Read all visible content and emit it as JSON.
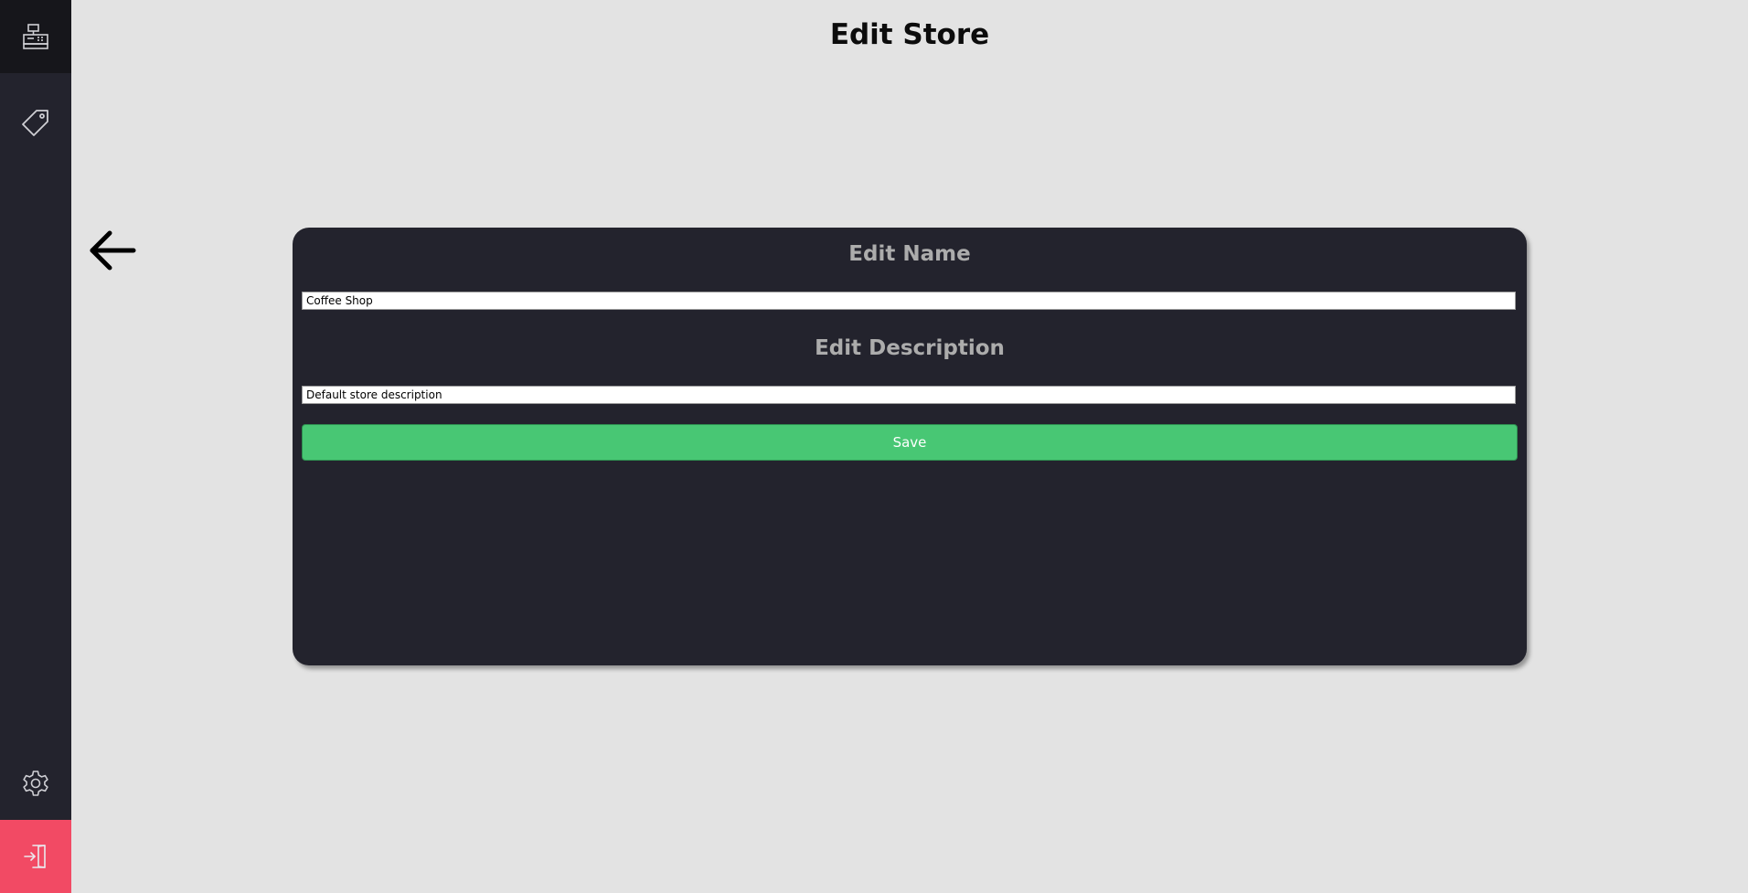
{
  "page": {
    "title": "Edit Store"
  },
  "sidebar": {
    "items": [
      {
        "name": "register",
        "icon": "cash-register-icon"
      },
      {
        "name": "tags",
        "icon": "tag-icon"
      },
      {
        "name": "settings",
        "icon": "gear-icon"
      },
      {
        "name": "logout",
        "icon": "logout-icon"
      }
    ],
    "colors": {
      "background": "#23232d",
      "active": "#16161b",
      "logout": "#f24a64"
    }
  },
  "back": {
    "icon": "arrow-left-icon"
  },
  "form": {
    "name_heading": "Edit Name",
    "name_value": "Coffee Shop",
    "description_heading": "Edit Description",
    "description_value": "Default store description",
    "save_label": "Save",
    "save_color": "#48c774"
  }
}
